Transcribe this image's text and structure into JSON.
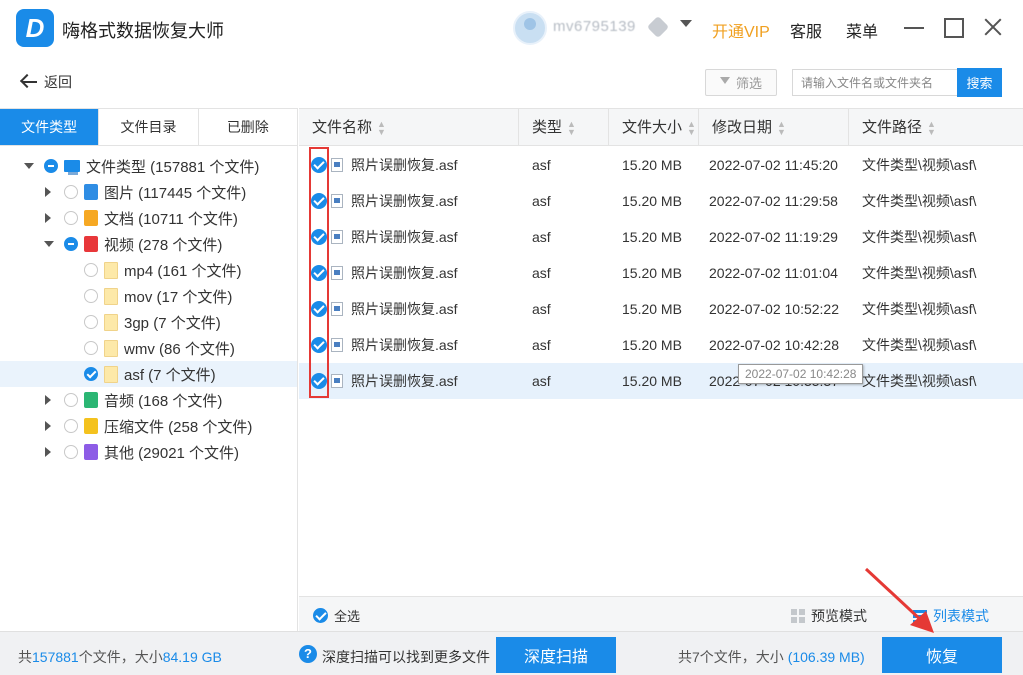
{
  "app": {
    "title": "嗨格式数据恢复大师",
    "logo_letter": "D",
    "username": "mv6795139",
    "vip_label": "开通VIP",
    "service_label": "客服",
    "menu_label": "菜单",
    "accent_color": "#1a8be8",
    "vip_color": "#f0a020"
  },
  "toolbar": {
    "back_label": "返回",
    "filter_label": "筛选",
    "search_placeholder": "请输入文件名或文件夹名",
    "search_value": "",
    "search_button": "搜索"
  },
  "left_tabs": [
    {
      "label": "文件类型",
      "active": true
    },
    {
      "label": "文件目录",
      "active": false
    },
    {
      "label": "已删除",
      "active": false
    }
  ],
  "tree": [
    {
      "label": "文件类型 (157881 个文件)",
      "icon": "root-icon",
      "state": "partial",
      "expander": "down",
      "level": 0
    },
    {
      "label": "图片 (117445 个文件)",
      "icon": "image-icon",
      "state": "none",
      "expander": "right",
      "level": 1
    },
    {
      "label": "文档 (10711 个文件)",
      "icon": "document-icon",
      "state": "none",
      "expander": "right",
      "level": 1
    },
    {
      "label": "视频 (278 个文件)",
      "icon": "video-icon",
      "state": "partial",
      "expander": "down",
      "level": 1
    },
    {
      "label": "mp4 (161 个文件)",
      "icon": "folder-icon",
      "state": "none",
      "expander": "",
      "level": 2
    },
    {
      "label": "mov (17 个文件)",
      "icon": "folder-icon",
      "state": "none",
      "expander": "",
      "level": 2
    },
    {
      "label": "3gp (7 个文件)",
      "icon": "folder-icon",
      "state": "none",
      "expander": "",
      "level": 2
    },
    {
      "label": "wmv (86 个文件)",
      "icon": "folder-icon",
      "state": "none",
      "expander": "",
      "level": 2
    },
    {
      "label": "asf (7 个文件)",
      "icon": "folder-icon",
      "state": "checked",
      "expander": "",
      "level": 2,
      "selected": true
    },
    {
      "label": "音频 (168 个文件)",
      "icon": "audio-icon",
      "state": "none",
      "expander": "right",
      "level": 1
    },
    {
      "label": "压缩文件 (258 个文件)",
      "icon": "archive-icon",
      "state": "none",
      "expander": "right",
      "level": 1
    },
    {
      "label": "其他 (29021 个文件)",
      "icon": "other-icon",
      "state": "none",
      "expander": "right",
      "level": 1
    }
  ],
  "table": {
    "columns": [
      "文件名称",
      "类型",
      "文件大小",
      "修改日期",
      "文件路径"
    ],
    "rows": [
      {
        "name": "照片误删恢复.asf",
        "type": "asf",
        "size": "15.20 MB",
        "date": "2022-07-02 11:45:20",
        "path": "文件类型\\视频\\asf\\"
      },
      {
        "name": "照片误删恢复.asf",
        "type": "asf",
        "size": "15.20 MB",
        "date": "2022-07-02 11:29:58",
        "path": "文件类型\\视频\\asf\\"
      },
      {
        "name": "照片误删恢复.asf",
        "type": "asf",
        "size": "15.20 MB",
        "date": "2022-07-02 11:19:29",
        "path": "文件类型\\视频\\asf\\"
      },
      {
        "name": "照片误删恢复.asf",
        "type": "asf",
        "size": "15.20 MB",
        "date": "2022-07-02 11:01:04",
        "path": "文件类型\\视频\\asf\\"
      },
      {
        "name": "照片误删恢复.asf",
        "type": "asf",
        "size": "15.20 MB",
        "date": "2022-07-02 10:52:22",
        "path": "文件类型\\视频\\asf\\"
      },
      {
        "name": "照片误删恢复.asf",
        "type": "asf",
        "size": "15.20 MB",
        "date": "2022-07-02 10:42:28",
        "path": "文件类型\\视频\\asf\\"
      },
      {
        "name": "照片误删恢复.asf",
        "type": "asf",
        "size": "15.20 MB",
        "date": "2022-07-02 10:35:37",
        "path": "文件类型\\视频\\asf\\",
        "highlight": true
      }
    ],
    "tooltip": "2022-07-02 10:42:28"
  },
  "footer": {
    "select_all": "全选",
    "preview_mode": "预览模式",
    "list_mode": "列表模式"
  },
  "status": {
    "total_prefix": "共",
    "total_count": "157881",
    "total_mid": "个文件，大小",
    "total_size": "84.19 GB",
    "deep_hint": "深度扫描可以找到更多文件",
    "deep_button": "深度扫描",
    "selected_prefix": "共7个文件，大小",
    "selected_size": "(106.39 MB)",
    "recover_button": "恢复"
  }
}
